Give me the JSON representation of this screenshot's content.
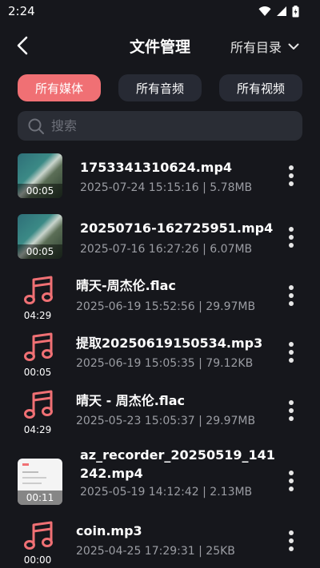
{
  "status_bar": {
    "time": "2:24"
  },
  "header": {
    "title": "文件管理",
    "directory_selector": "所有目录"
  },
  "tabs": [
    {
      "label": "所有媒体",
      "active": true
    },
    {
      "label": "所有音频",
      "active": false
    },
    {
      "label": "所有视频",
      "active": false
    }
  ],
  "search": {
    "placeholder": "搜索",
    "value": ""
  },
  "files": [
    {
      "kind": "video",
      "thumbnail": "aerial",
      "duration": "00:05",
      "name_lines": [
        "1753341310624.mp4"
      ],
      "meta": "2025-07-24 15:15:16 | 5.78MB"
    },
    {
      "kind": "video",
      "thumbnail": "aerial",
      "duration": "00:05",
      "name_lines": [
        "20250716-162725951.mp4"
      ],
      "meta": "2025-07-16 16:27:26 | 6.07MB"
    },
    {
      "kind": "audio",
      "duration": "04:29",
      "name_lines": [
        "晴天-周杰伦.flac"
      ],
      "meta": "2025-06-19 15:52:56 | 29.97MB"
    },
    {
      "kind": "audio",
      "duration": "00:05",
      "name_lines": [
        "提取20250619150534.mp3"
      ],
      "meta": "2025-06-19 15:05:35 | 79.12KB"
    },
    {
      "kind": "audio",
      "duration": "04:29",
      "name_lines": [
        "晴天 - 周杰伦.flac"
      ],
      "meta": "2025-05-23 15:05:37 | 29.97MB"
    },
    {
      "kind": "video",
      "thumbnail": "document",
      "duration": "00:11",
      "name_lines": [
        "az_recorder_20250519_141",
        "242.mp4"
      ],
      "meta": "2025-05-19 14:12:42 | 2.13MB"
    },
    {
      "kind": "audio",
      "duration": "00:00",
      "name_lines": [
        "coin.mp3"
      ],
      "meta": "2025-04-25 17:29:31 | 25KB"
    }
  ],
  "colors": {
    "background": "#16171c",
    "accent": "#f07074",
    "tab_inactive": "#272a34",
    "search_bg": "#2a2d35",
    "meta_text": "#9b9da3"
  },
  "icons": {
    "back": "chevron-left-icon",
    "directory": "chevron-down-icon",
    "search": "search-icon",
    "audio": "music-note-icon",
    "more": "more-vertical-icon"
  }
}
